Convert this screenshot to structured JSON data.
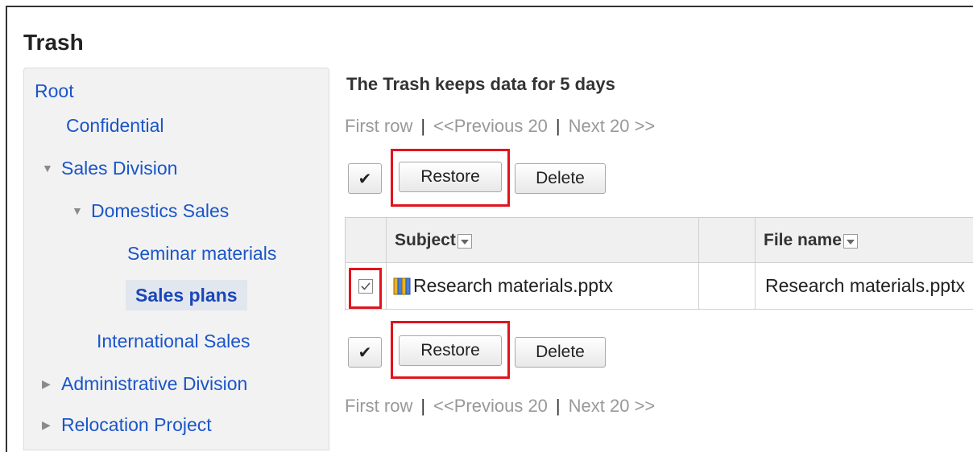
{
  "page": {
    "title": "Trash"
  },
  "sidebar": {
    "items": [
      {
        "label": "Root",
        "expander": ""
      },
      {
        "label": "Confidential",
        "expander": ""
      },
      {
        "label": "Sales Division",
        "expander": "expanded"
      },
      {
        "label": "Domestics Sales",
        "expander": "expanded"
      },
      {
        "label": "Seminar materials",
        "expander": ""
      },
      {
        "label": "Sales plans",
        "expander": "",
        "selected": true
      },
      {
        "label": "International Sales",
        "expander": ""
      },
      {
        "label": "Administrative Division",
        "expander": "collapsed"
      },
      {
        "label": "Relocation Project",
        "expander": "collapsed"
      }
    ]
  },
  "main": {
    "notice": "The Trash keeps data for 5 days",
    "pager": {
      "first": "First row",
      "sep": "|",
      "previous": "<<Previous 20",
      "next": "Next 20 >>"
    },
    "actions": {
      "check_all": "✔",
      "restore": "Restore",
      "delete": "Delete"
    },
    "table": {
      "headers": [
        "Subject",
        "File name"
      ],
      "rows": [
        {
          "checked": true,
          "subject": "Research materials.pptx",
          "file_name": "Research materials.pptx"
        }
      ]
    }
  },
  "colors": {
    "link": "#1a55c9",
    "highlight": "#e0141e",
    "pager_text": "#999999"
  }
}
